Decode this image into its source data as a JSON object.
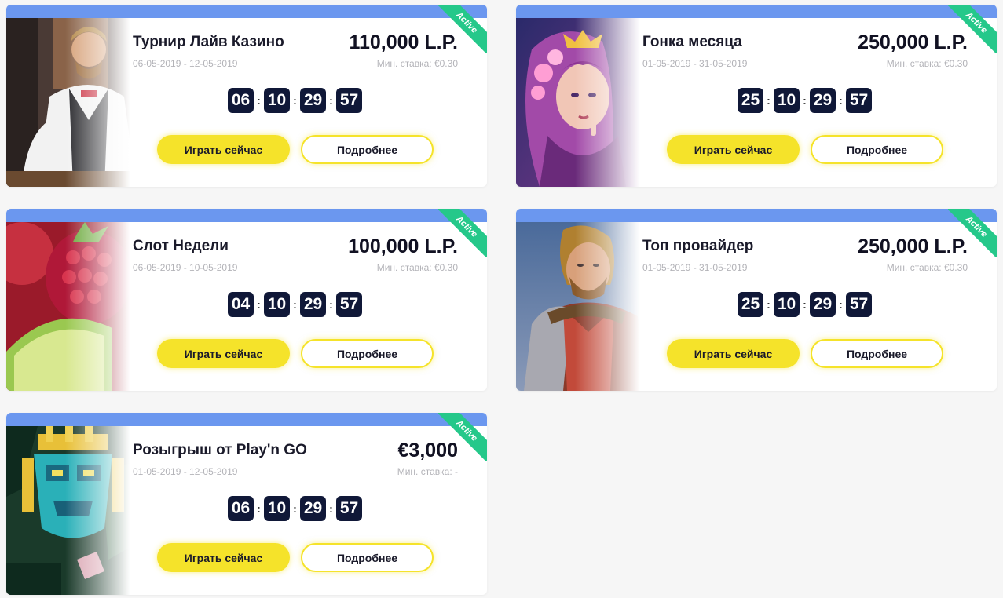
{
  "labels": {
    "active": "Active",
    "play": "Играть сейчас",
    "details": "Подробнее"
  },
  "colors": {
    "topbar": "#6b97ef",
    "active_ribbon": "#25c88a",
    "play_button": "#f5e32a",
    "countdown_box": "#101838"
  },
  "tournaments": [
    {
      "title": "Турнир Лайв Казино",
      "dates": "06-05-2019 - 12-05-2019",
      "prize": "110,000 L.P.",
      "min_bet": "Мин. ставка: €0.30",
      "countdown": [
        "06",
        "10",
        "29",
        "57"
      ],
      "image": "live-dealer-image"
    },
    {
      "title": "Гонка месяца",
      "dates": "01-05-2019 - 31-05-2019",
      "prize": "250,000 L.P.",
      "min_bet": "Мин. ставка: €0.30",
      "countdown": [
        "25",
        "10",
        "29",
        "57"
      ],
      "image": "fairy-character-image"
    },
    {
      "title": "Слот Недели",
      "dates": "06-05-2019 - 10-05-2019",
      "prize": "100,000 L.P.",
      "min_bet": "Мин. ставка: €0.30",
      "countdown": [
        "04",
        "10",
        "29",
        "57"
      ],
      "image": "fruit-slot-image"
    },
    {
      "title": "Топ провайдер",
      "dates": "01-05-2019 - 31-05-2019",
      "prize": "250,000 L.P.",
      "min_bet": "Мин. ставка: €0.30",
      "countdown": [
        "25",
        "10",
        "29",
        "57"
      ],
      "image": "knight-character-image"
    },
    {
      "title": "Розыгрыш от Play'n GO",
      "dates": "01-05-2019 - 12-05-2019",
      "prize": "€3,000",
      "min_bet": "Мин. ставка: -",
      "countdown": [
        "06",
        "10",
        "29",
        "57"
      ],
      "image": "aztec-mask-image"
    }
  ]
}
